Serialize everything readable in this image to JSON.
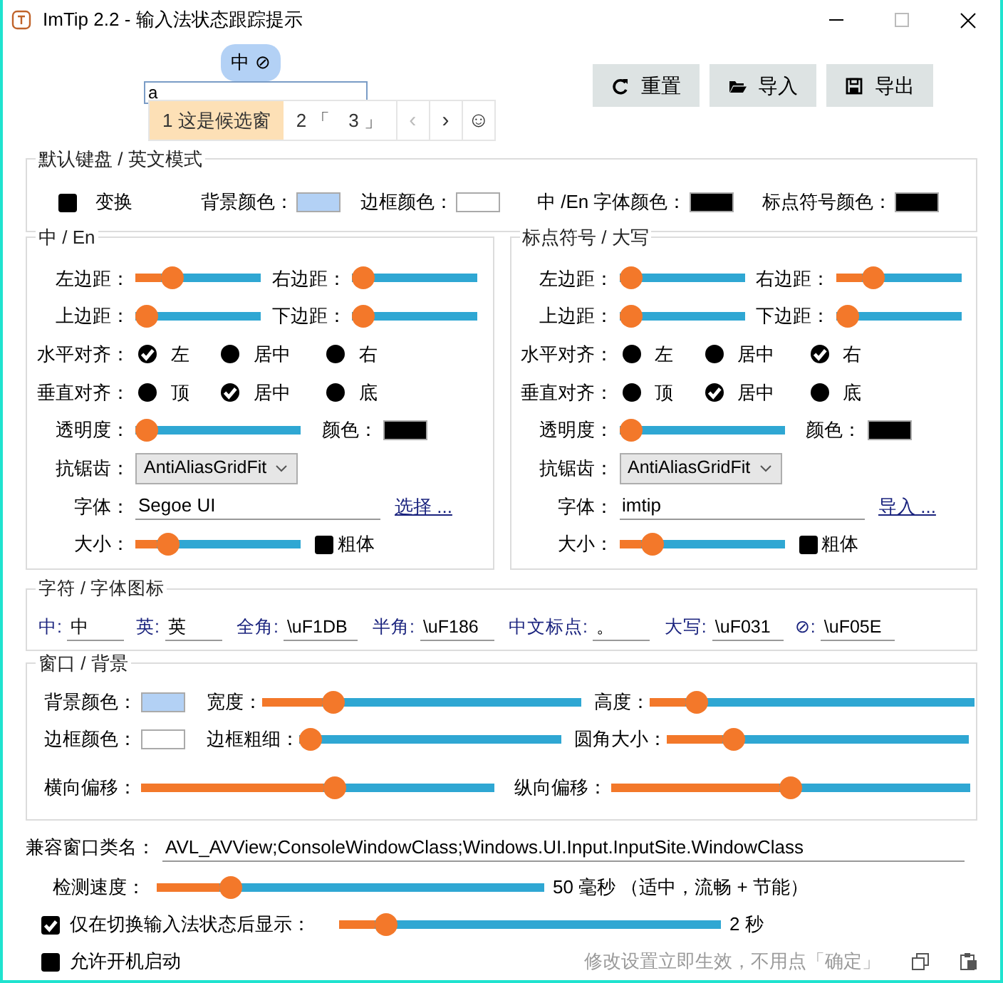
{
  "window": {
    "title": "ImTip 2.2 - 输入法状态跟踪提示"
  },
  "preview": {
    "indicator": "中 ⊘",
    "input_value": "a",
    "candidates": [
      {
        "text": "1 这是候选窗",
        "selected": true
      },
      {
        "text": "2 「　3 」",
        "selected": false
      }
    ],
    "nav": [
      {
        "text": "‹",
        "disabled": true
      },
      {
        "text": "›",
        "disabled": false
      },
      {
        "text": "☺",
        "disabled": false
      }
    ]
  },
  "buttons": [
    {
      "kind": "refresh",
      "label": "重置"
    },
    {
      "kind": "folder",
      "label": "导入"
    },
    {
      "kind": "save",
      "label": "导出"
    }
  ],
  "default_keyboard": {
    "title": "默认键盘 / 英文模式",
    "toggle": {
      "label": "变换",
      "checked": false
    },
    "colors": [
      {
        "label": "背景颜色：",
        "color": "#b3d1f5"
      },
      {
        "label": "边框颜色：",
        "color": "#ffffff"
      },
      {
        "label": "中 /En 字体颜色：",
        "color": "#000000"
      },
      {
        "label": "标点符号颜色：",
        "color": "#000000"
      }
    ]
  },
  "panels": [
    {
      "title": "中 / En",
      "margins": [
        {
          "label": "左边距：",
          "level": 0.25
        },
        {
          "label": "右边距：",
          "level": 0
        },
        {
          "label": "上边距：",
          "level": 0
        },
        {
          "label": "下边距：",
          "level": 0
        }
      ],
      "aligns": [
        {
          "label": "水平对齐：",
          "options": [
            {
              "label": "左",
              "selected": true
            },
            {
              "label": "居中",
              "selected": false
            },
            {
              "label": "右",
              "selected": false
            }
          ]
        },
        {
          "label": "垂直对齐：",
          "options": [
            {
              "label": "顶",
              "selected": false
            },
            {
              "label": "居中",
              "selected": true
            },
            {
              "label": "底",
              "selected": false
            }
          ]
        }
      ],
      "opacity": {
        "label": "透明度：",
        "level": 0
      },
      "color": {
        "label": "颜色：",
        "color": "#000000"
      },
      "antialias": {
        "label": "抗锯齿：",
        "value": "AntiAliasGridFit"
      },
      "font": {
        "label": "字体：",
        "value": "Segoe UI",
        "link": "选择 ..."
      },
      "size": {
        "label": "大小：",
        "level": 0.15
      },
      "bold": {
        "label": "粗体",
        "checked": false
      }
    },
    {
      "title": "标点符号 / 大写",
      "margins": [
        {
          "label": "左边距：",
          "level": 0
        },
        {
          "label": "右边距：",
          "level": 0.25
        },
        {
          "label": "上边距：",
          "level": 0
        },
        {
          "label": "下边距：",
          "level": 0
        }
      ],
      "aligns": [
        {
          "label": "水平对齐：",
          "options": [
            {
              "label": "左",
              "selected": false
            },
            {
              "label": "居中",
              "selected": false
            },
            {
              "label": "右",
              "selected": true
            }
          ]
        },
        {
          "label": "垂直对齐：",
          "options": [
            {
              "label": "顶",
              "selected": false
            },
            {
              "label": "居中",
              "selected": true
            },
            {
              "label": "底",
              "selected": false
            }
          ]
        }
      ],
      "opacity": {
        "label": "透明度：",
        "level": 0
      },
      "color": {
        "label": "颜色：",
        "color": "#000000"
      },
      "antialias": {
        "label": "抗锯齿：",
        "value": "AntiAliasGridFit"
      },
      "font": {
        "label": "字体：",
        "value": "imtip",
        "link": "导入 ..."
      },
      "size": {
        "label": "大小：",
        "level": 0.15
      },
      "bold": {
        "label": "粗体",
        "checked": false
      }
    }
  ],
  "glyphs": {
    "title": "字符 /  字体图标",
    "fields": [
      {
        "label": "中:",
        "value": "中"
      },
      {
        "label": "英:",
        "value": "英"
      },
      {
        "label": "全角:",
        "value": "\\uF1DB"
      },
      {
        "label": "半角:",
        "value": "\\uF186"
      },
      {
        "label": "中文标点:",
        "value": "。"
      },
      {
        "label": "大写:",
        "value": "\\uF031"
      },
      {
        "label": "⊘:",
        "value": "\\uF05E"
      }
    ]
  },
  "window_bg": {
    "title": "窗口 / 背景",
    "rows": [
      {
        "label": "背景颜色：",
        "color": "#b3d1f5",
        "sliders": [
          {
            "label": "宽度：",
            "level": 0.2
          },
          {
            "label": "高度：",
            "level": 0.12
          }
        ]
      },
      {
        "label": "边框颜色：",
        "color": "#ffffff",
        "sliders": [
          {
            "label": "边框粗细：",
            "level": 0
          },
          {
            "label": "圆角大小：",
            "level": 0.2
          }
        ]
      }
    ],
    "offsets": [
      {
        "label": "横向偏移：",
        "level": 0.55
      },
      {
        "label": "纵向偏移：",
        "level": 0.5
      }
    ]
  },
  "compat": {
    "label": "兼容窗口类名：",
    "value": "AVL_AVView;ConsoleWindowClass;Windows.UI.Input.InputSite.WindowClass"
  },
  "speed": {
    "label": "检测速度：",
    "level": 0.17,
    "reading": "50 毫秒 （适中，流畅 + 节能）"
  },
  "show_after": {
    "label": "仅在切换输入法状态后显示：",
    "checked": true,
    "level": 0.1,
    "reading": "2 秒"
  },
  "autostart": {
    "label": "允许开机启动",
    "checked": false
  },
  "hint": "修改设置立即生效，不用点「确定」"
}
